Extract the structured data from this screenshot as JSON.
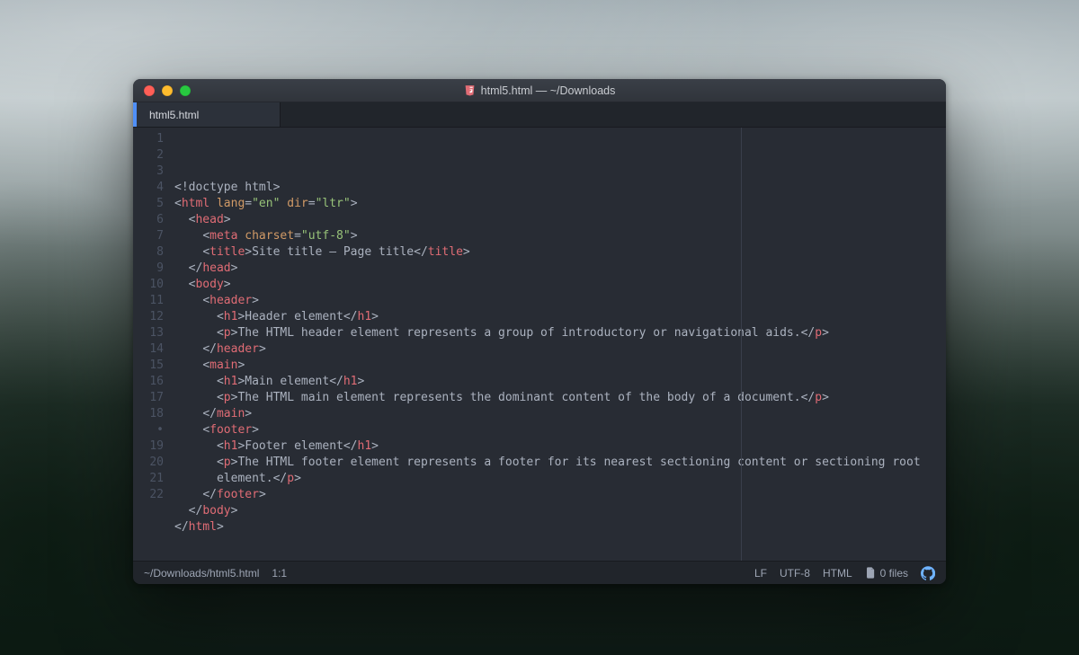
{
  "window": {
    "title": "html5.html — ~/Downloads"
  },
  "tab": {
    "label": "html5.html"
  },
  "gutter": {
    "lines": [
      "1",
      "2",
      "3",
      "4",
      "5",
      "6",
      "7",
      "8",
      "9",
      "10",
      "11",
      "12",
      "13",
      "14",
      "15",
      "16",
      "17",
      "18",
      "•",
      "19",
      "20",
      "21",
      "22"
    ]
  },
  "code_plain": [
    "<!doctype html>",
    "<html lang=\"en\" dir=\"ltr\">",
    "  <head>",
    "    <meta charset=\"utf-8\">",
    "    <title>Site title – Page title</title>",
    "  </head>",
    "  <body>",
    "    <header>",
    "      <h1>Header element</h1>",
    "      <p>The HTML header element represents a group of introductory or navigational aids.</p>",
    "    </header>",
    "    <main>",
    "      <h1>Main element</h1>",
    "      <p>The HTML main element represents the dominant content of the body of a document.</p>",
    "    </main>",
    "    <footer>",
    "      <h1>Footer element</h1>",
    "      <p>The HTML footer element represents a footer for its nearest sectioning content or sectioning root",
    "      element.</p>",
    "    </footer>",
    "  </body>",
    "</html>",
    ""
  ],
  "status": {
    "path": "~/Downloads/html5.html",
    "cursor": "1:1",
    "eol": "LF",
    "encoding": "UTF-8",
    "language": "HTML",
    "git_files": "0 files"
  }
}
